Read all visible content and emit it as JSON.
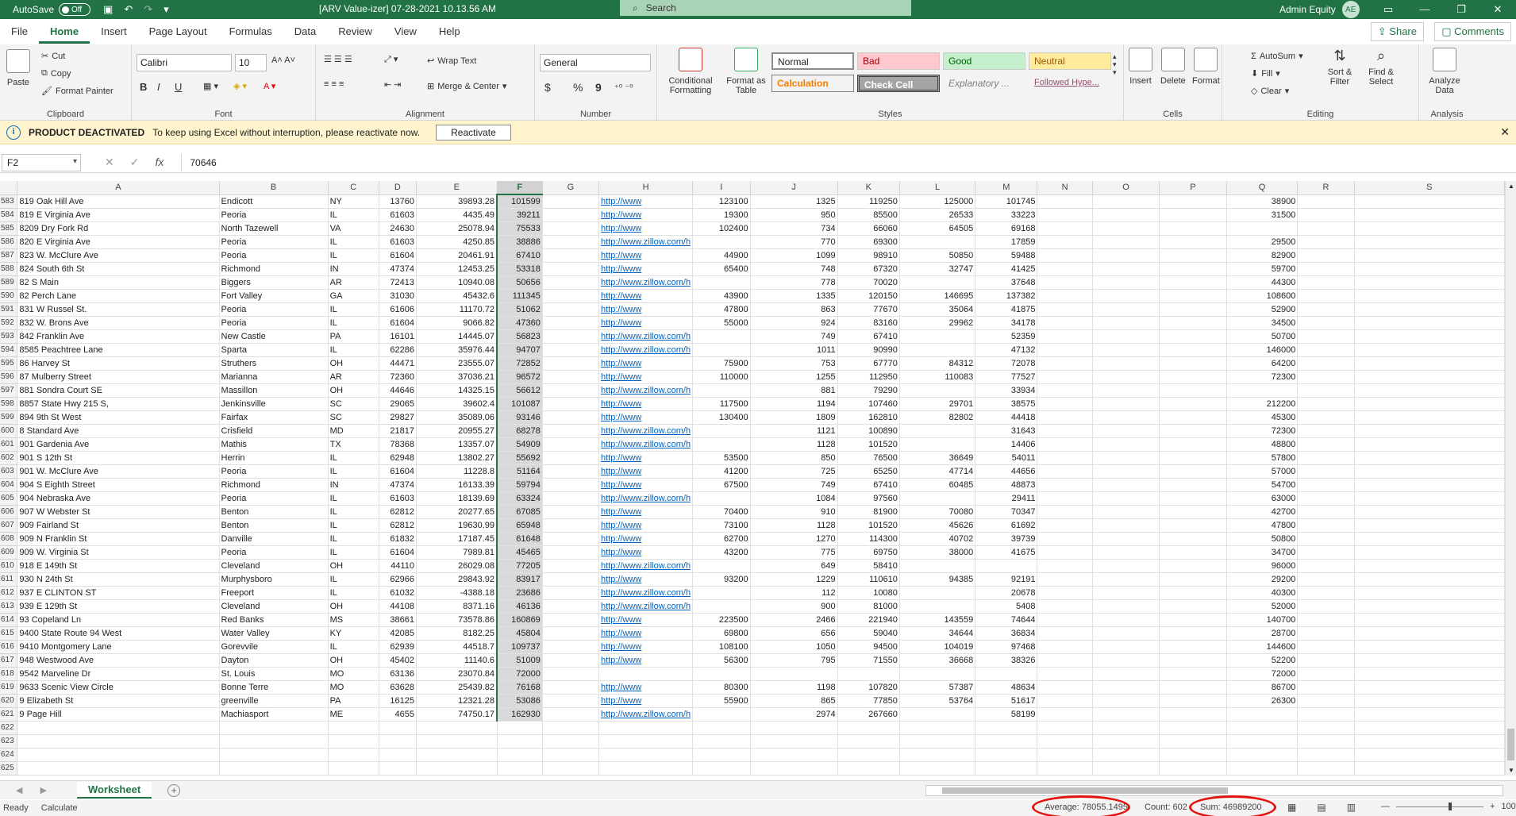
{
  "titlebar": {
    "autosave_label": "AutoSave",
    "autosave_state": "Off",
    "document_title": "[ARV Value-izer] 07-28-2021 10.13.56 AM",
    "search_placeholder": "Search",
    "account_name": "Admin Equity",
    "account_initials": "AE"
  },
  "ribbon_tabs": [
    "File",
    "Home",
    "Insert",
    "Page Layout",
    "Formulas",
    "Data",
    "Review",
    "View",
    "Help"
  ],
  "ribbon_actions": {
    "share": "Share",
    "comments": "Comments"
  },
  "ribbon": {
    "clipboard": {
      "label": "Clipboard",
      "paste": "Paste",
      "cut": "Cut",
      "copy": "Copy",
      "format_painter": "Format Painter"
    },
    "font": {
      "label": "Font",
      "family": "Calibri",
      "size": "10",
      "bold": "B",
      "italic": "I",
      "underline": "U"
    },
    "alignment": {
      "label": "Alignment",
      "wrap_text": "Wrap Text",
      "merge_center": "Merge & Center"
    },
    "number": {
      "label": "Number",
      "format": "General",
      "currency": "$",
      "percent": "%",
      "comma": "9"
    },
    "styles": {
      "label": "Styles",
      "conditional_formatting": "Conditional Formatting",
      "format_as_table": "Format as Table",
      "normal": "Normal",
      "bad": "Bad",
      "good": "Good",
      "neutral": "Neutral",
      "calculation": "Calculation",
      "check_cell": "Check Cell",
      "explanatory": "Explanatory ...",
      "followed_hyperlink": "Followed Hype..."
    },
    "cells": {
      "label": "Cells",
      "insert": "Insert",
      "delete": "Delete",
      "format": "Format"
    },
    "editing": {
      "label": "Editing",
      "autosum": "AutoSum",
      "fill": "Fill",
      "clear": "Clear",
      "sort_filter": "Sort & Filter",
      "find_select": "Find & Select"
    },
    "analysis": {
      "label": "Analysis",
      "analyze_data": "Analyze Data"
    }
  },
  "message_bar": {
    "title": "PRODUCT DEACTIVATED",
    "text": "To keep using Excel without interruption, please reactivate now.",
    "button": "Reactivate"
  },
  "formula_bar": {
    "name_box": "F2",
    "value": "70646"
  },
  "columns": [
    "A",
    "B",
    "C",
    "D",
    "E",
    "F",
    "G",
    "H",
    "I",
    "J",
    "K",
    "L",
    "M",
    "N",
    "O",
    "P",
    "Q",
    "R",
    "S"
  ],
  "selected_column": "F",
  "rows": [
    {
      "n": "583",
      "A": "819 Oak Hill Ave",
      "B": "Endicott",
      "C": "NY",
      "D": "13760",
      "E": "39893.28",
      "F": "101599",
      "H": "http://www",
      "I": "123100",
      "J": "1325",
      "K": "119250",
      "L": "125000",
      "M": "101745",
      "Q": "38900"
    },
    {
      "n": "584",
      "A": "819 E Virginia Ave",
      "B": "Peoria",
      "C": "IL",
      "D": "61603",
      "E": "4435.49",
      "F": "39211",
      "H": "http://www",
      "I": "19300",
      "J": "950",
      "K": "85500",
      "L": "26533",
      "M": "33223",
      "Q": "31500"
    },
    {
      "n": "585",
      "A": "8209 Dry Fork Rd",
      "B": "North Tazewell",
      "C": "VA",
      "D": "24630",
      "E": "25078.94",
      "F": "75533",
      "H": "http://www",
      "I": "102400",
      "J": "734",
      "K": "66060",
      "L": "64505",
      "M": "69168",
      "Q": ""
    },
    {
      "n": "586",
      "A": "820 E Virginia Ave",
      "B": "Peoria",
      "C": "IL",
      "D": "61603",
      "E": "4250.85",
      "F": "38886",
      "H": "http://www.zillow.com/h",
      "I": "",
      "J": "770",
      "K": "69300",
      "L": "",
      "M": "17859",
      "Q": "29500"
    },
    {
      "n": "587",
      "A": "823 W. McClure Ave",
      "B": "Peoria",
      "C": "IL",
      "D": "61604",
      "E": "20461.91",
      "F": "67410",
      "H": "http://www",
      "I": "44900",
      "J": "1099",
      "K": "98910",
      "L": "50850",
      "M": "59488",
      "Q": "82900"
    },
    {
      "n": "588",
      "A": "824 South 6th St",
      "B": "Richmond",
      "C": "IN",
      "D": "47374",
      "E": "12453.25",
      "F": "53318",
      "H": "http://www",
      "I": "65400",
      "J": "748",
      "K": "67320",
      "L": "32747",
      "M": "41425",
      "Q": "59700"
    },
    {
      "n": "589",
      "A": "82 S Main",
      "B": "Biggers",
      "C": "AR",
      "D": "72413",
      "E": "10940.08",
      "F": "50656",
      "H": "http://www.zillow.com/h",
      "I": "",
      "J": "778",
      "K": "70020",
      "L": "",
      "M": "37648",
      "Q": "44300"
    },
    {
      "n": "590",
      "A": "82 Perch Lane",
      "B": "Fort Valley",
      "C": "GA",
      "D": "31030",
      "E": "45432.6",
      "F": "111345",
      "H": "http://www",
      "I": "43900",
      "J": "1335",
      "K": "120150",
      "L": "146695",
      "M": "137382",
      "Q": "108600"
    },
    {
      "n": "591",
      "A": "831 W Russel St.",
      "B": "Peoria",
      "C": "IL",
      "D": "61606",
      "E": "11170.72",
      "F": "51062",
      "H": "http://www",
      "I": "47800",
      "J": "863",
      "K": "77670",
      "L": "35064",
      "M": "41875",
      "Q": "52900"
    },
    {
      "n": "592",
      "A": "832 W. Brons Ave",
      "B": "Peoria",
      "C": "IL",
      "D": "61604",
      "E": "9066.82",
      "F": "47360",
      "H": "http://www",
      "I": "55000",
      "J": "924",
      "K": "83160",
      "L": "29962",
      "M": "34178",
      "Q": "34500"
    },
    {
      "n": "593",
      "A": "842 Franklin Ave",
      "B": "New Castle",
      "C": "PA",
      "D": "16101",
      "E": "14445.07",
      "F": "56823",
      "H": "http://www.zillow.com/h",
      "I": "",
      "J": "749",
      "K": "67410",
      "L": "",
      "M": "52359",
      "Q": "50700"
    },
    {
      "n": "594",
      "A": "8585 Peachtree Lane",
      "B": "Sparta",
      "C": "IL",
      "D": "62286",
      "E": "35976.44",
      "F": "94707",
      "H": "http://www.zillow.com/h",
      "I": "",
      "J": "1011",
      "K": "90990",
      "L": "",
      "M": "47132",
      "Q": "146000"
    },
    {
      "n": "595",
      "A": "86 Harvey St",
      "B": "Struthers",
      "C": "OH",
      "D": "44471",
      "E": "23555.07",
      "F": "72852",
      "H": "http://www",
      "I": "75900",
      "J": "753",
      "K": "67770",
      "L": "84312",
      "M": "72078",
      "Q": "64200"
    },
    {
      "n": "596",
      "A": "87 Mulberry Street",
      "B": "Marianna",
      "C": "AR",
      "D": "72360",
      "E": "37036.21",
      "F": "96572",
      "H": "http://www",
      "I": "110000",
      "J": "1255",
      "K": "112950",
      "L": "110083",
      "M": "77527",
      "Q": "72300"
    },
    {
      "n": "597",
      "A": "881 Sondra Court SE",
      "B": "Massillon",
      "C": "OH",
      "D": "44646",
      "E": "14325.15",
      "F": "56612",
      "H": "http://www.zillow.com/h",
      "I": "",
      "J": "881",
      "K": "79290",
      "L": "",
      "M": "33934",
      "Q": ""
    },
    {
      "n": "598",
      "A": "8857 State Hwy 215 S,",
      "B": "Jenkinsville",
      "C": "SC",
      "D": "29065",
      "E": "39602.4",
      "F": "101087",
      "H": "http://www",
      "I": "117500",
      "J": "1194",
      "K": "107460",
      "L": "29701",
      "M": "38575",
      "Q": "212200"
    },
    {
      "n": "599",
      "A": "894 9th St West",
      "B": "Fairfax",
      "C": "SC",
      "D": "29827",
      "E": "35089.06",
      "F": "93146",
      "H": "http://www",
      "I": "130400",
      "J": "1809",
      "K": "162810",
      "L": "82802",
      "M": "44418",
      "Q": "45300"
    },
    {
      "n": "600",
      "A": "8 Standard Ave",
      "B": "Crisfield",
      "C": "MD",
      "D": "21817",
      "E": "20955.27",
      "F": "68278",
      "H": "http://www.zillow.com/h",
      "I": "",
      "J": "1121",
      "K": "100890",
      "L": "",
      "M": "31643",
      "Q": "72300"
    },
    {
      "n": "601",
      "A": "901 Gardenia Ave",
      "B": "Mathis",
      "C": "TX",
      "D": "78368",
      "E": "13357.07",
      "F": "54909",
      "H": "http://www.zillow.com/h",
      "I": "",
      "J": "1128",
      "K": "101520",
      "L": "",
      "M": "14406",
      "Q": "48800"
    },
    {
      "n": "602",
      "A": "901 S 12th St",
      "B": "Herrin",
      "C": "IL",
      "D": "62948",
      "E": "13802.27",
      "F": "55692",
      "H": "http://www",
      "I": "53500",
      "J": "850",
      "K": "76500",
      "L": "36649",
      "M": "54011",
      "Q": "57800"
    },
    {
      "n": "603",
      "A": "901 W. McClure Ave",
      "B": "Peoria",
      "C": "IL",
      "D": "61604",
      "E": "11228.8",
      "F": "51164",
      "H": "http://www",
      "I": "41200",
      "J": "725",
      "K": "65250",
      "L": "47714",
      "M": "44656",
      "Q": "57000"
    },
    {
      "n": "604",
      "A": "904 S Eighth Street",
      "B": "Richmond",
      "C": "IN",
      "D": "47374",
      "E": "16133.39",
      "F": "59794",
      "H": "http://www",
      "I": "67500",
      "J": "749",
      "K": "67410",
      "L": "60485",
      "M": "48873",
      "Q": "54700"
    },
    {
      "n": "605",
      "A": "904 Nebraska Ave",
      "B": "Peoria",
      "C": "IL",
      "D": "61603",
      "E": "18139.69",
      "F": "63324",
      "H": "http://www.zillow.com/h",
      "I": "",
      "J": "1084",
      "K": "97560",
      "L": "",
      "M": "29411",
      "Q": "63000"
    },
    {
      "n": "606",
      "A": "907 W Webster St",
      "B": "Benton",
      "C": "IL",
      "D": "62812",
      "E": "20277.65",
      "F": "67085",
      "H": "http://www",
      "I": "70400",
      "J": "910",
      "K": "81900",
      "L": "70080",
      "M": "70347",
      "Q": "42700"
    },
    {
      "n": "607",
      "A": "909 Fairland St",
      "B": "Benton",
      "C": "IL",
      "D": "62812",
      "E": "19630.99",
      "F": "65948",
      "H": "http://www",
      "I": "73100",
      "J": "1128",
      "K": "101520",
      "L": "45626",
      "M": "61692",
      "Q": "47800"
    },
    {
      "n": "608",
      "A": "909 N Franklin St",
      "B": "Danville",
      "C": "IL",
      "D": "61832",
      "E": "17187.45",
      "F": "61648",
      "H": "http://www",
      "I": "62700",
      "J": "1270",
      "K": "114300",
      "L": "40702",
      "M": "39739",
      "Q": "50800"
    },
    {
      "n": "609",
      "A": "909 W. Virginia St",
      "B": "Peoria",
      "C": "IL",
      "D": "61604",
      "E": "7989.81",
      "F": "45465",
      "H": "http://www",
      "I": "43200",
      "J": "775",
      "K": "69750",
      "L": "38000",
      "M": "41675",
      "Q": "34700"
    },
    {
      "n": "610",
      "A": "918 E 149th St",
      "B": "Cleveland",
      "C": "OH",
      "D": "44110",
      "E": "26029.08",
      "F": "77205",
      "H": "http://www.zillow.com/h",
      "I": "",
      "J": "649",
      "K": "58410",
      "L": "",
      "M": "",
      "Q": "96000"
    },
    {
      "n": "611",
      "A": "930 N 24th St",
      "B": "Murphysboro",
      "C": "IL",
      "D": "62966",
      "E": "29843.92",
      "F": "83917",
      "H": "http://www",
      "I": "93200",
      "J": "1229",
      "K": "110610",
      "L": "94385",
      "M": "92191",
      "Q": "29200"
    },
    {
      "n": "612",
      "A": "937 E CLINTON ST",
      "B": "Freeport",
      "C": "IL",
      "D": "61032",
      "E": "-4388.18",
      "F": "23686",
      "H": "http://www.zillow.com/h",
      "I": "",
      "J": "112",
      "K": "10080",
      "L": "",
      "M": "20678",
      "Q": "40300"
    },
    {
      "n": "613",
      "A": "939 E 129th St",
      "B": "Cleveland",
      "C": "OH",
      "D": "44108",
      "E": "8371.16",
      "F": "46136",
      "H": "http://www.zillow.com/h",
      "I": "",
      "J": "900",
      "K": "81000",
      "L": "",
      "M": "5408",
      "Q": "52000"
    },
    {
      "n": "614",
      "A": "93 Copeland Ln",
      "B": "Red Banks",
      "C": "MS",
      "D": "38661",
      "E": "73578.86",
      "F": "160869",
      "H": "http://www",
      "I": "223500",
      "J": "2466",
      "K": "221940",
      "L": "143559",
      "M": "74644",
      "Q": "140700"
    },
    {
      "n": "615",
      "A": "9400 State Route 94 West",
      "B": "Water Valley",
      "C": "KY",
      "D": "42085",
      "E": "8182.25",
      "F": "45804",
      "H": "http://www",
      "I": "69800",
      "J": "656",
      "K": "59040",
      "L": "34644",
      "M": "36834",
      "Q": "28700"
    },
    {
      "n": "616",
      "A": "9410 Montgomery Lane",
      "B": "Gorevvile",
      "C": "IL",
      "D": "62939",
      "E": "44518.7",
      "F": "109737",
      "H": "http://www",
      "I": "108100",
      "J": "1050",
      "K": "94500",
      "L": "104019",
      "M": "97468",
      "Q": "144600"
    },
    {
      "n": "617",
      "A": "948 Westwood Ave",
      "B": "Dayton",
      "C": "OH",
      "D": "45402",
      "E": "11140.6",
      "F": "51009",
      "H": "http://www",
      "I": "56300",
      "J": "795",
      "K": "71550",
      "L": "36668",
      "M": "38326",
      "Q": "52200"
    },
    {
      "n": "618",
      "A": "9542 Marveline Dr",
      "B": "St. Louis",
      "C": "MO",
      "D": "63136",
      "E": "23070.84",
      "F": "72000",
      "H": "",
      "I": "",
      "J": "",
      "K": "",
      "L": "",
      "M": "",
      "Q": "72000"
    },
    {
      "n": "619",
      "A": "9633 Scenic View Circle",
      "B": "Bonne Terre",
      "C": "MO",
      "D": "63628",
      "E": "25439.82",
      "F": "76168",
      "H": "http://www",
      "I": "80300",
      "J": "1198",
      "K": "107820",
      "L": "57387",
      "M": "48634",
      "Q": "86700"
    },
    {
      "n": "620",
      "A": "9 Elizabeth St",
      "B": "greenville",
      "C": "PA",
      "D": "16125",
      "E": "12321.28",
      "F": "53086",
      "H": "http://www",
      "I": "55900",
      "J": "865",
      "K": "77850",
      "L": "53764",
      "M": "51617",
      "Q": "26300"
    },
    {
      "n": "621",
      "A": "9 Page Hill",
      "B": "Machiasport",
      "C": "ME",
      "D": "4655",
      "E": "74750.17",
      "F": "162930",
      "H": "http://www.zillow.com/h",
      "I": "",
      "J": "2974",
      "K": "267660",
      "L": "",
      "M": "58199",
      "Q": ""
    },
    {
      "n": "622"
    },
    {
      "n": "623"
    },
    {
      "n": "624"
    },
    {
      "n": "625"
    }
  ],
  "sheet_tabs": [
    "Worksheet"
  ],
  "status": {
    "ready": "Ready",
    "calculate": "Calculate",
    "average": "Average: 78055.1495",
    "count": "Count: 602",
    "sum": "Sum: 46989200",
    "zoom": "100%"
  },
  "colors": {
    "accent": "#217346",
    "annotation": "#e3140f",
    "link": "#0563c1"
  }
}
